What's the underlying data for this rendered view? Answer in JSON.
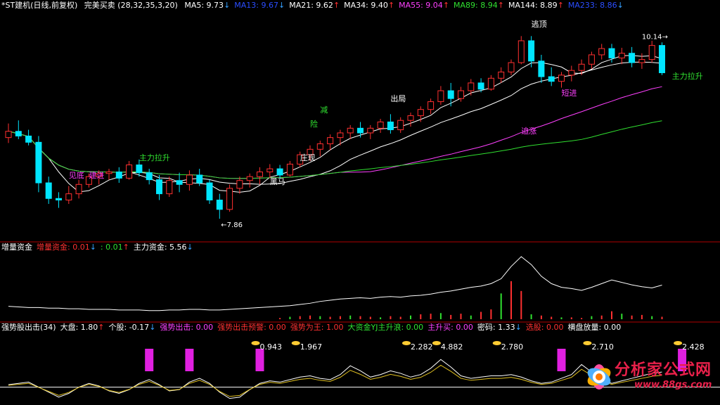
{
  "panel1": {
    "title": "*ST建机(日线,前复权)",
    "indicator": "完美买卖",
    "params": "(28,32,35,3,20)",
    "ma": [
      {
        "label": "MA5: 9.73",
        "arrow": "↓",
        "color": "#ffffff",
        "arrow_color": "#35a0ff"
      },
      {
        "label": "MA13: 9.67",
        "arrow": "↓",
        "color": "#2a4dff",
        "arrow_color": "#35a0ff"
      },
      {
        "label": "MA21: 9.62",
        "arrow": "↑",
        "color": "#ffffff",
        "arrow_color": "#ff3030"
      },
      {
        "label": "MA34: 9.40",
        "arrow": "↑",
        "color": "#ffffff",
        "arrow_color": "#ff3030"
      },
      {
        "label": "MA55: 9.04",
        "arrow": "↑",
        "color": "#ff40ff",
        "arrow_color": "#ff3030"
      },
      {
        "label": "MA89: 8.94",
        "arrow": "↑",
        "color": "#30e030",
        "arrow_color": "#ff3030"
      },
      {
        "label": "MA144: 8.89",
        "arrow": "↑",
        "color": "#ffffff",
        "arrow_color": "#ff3030"
      },
      {
        "label": "MA233: 8.86",
        "arrow": "↓",
        "color": "#2a4dff",
        "arrow_color": "#35a0ff"
      }
    ],
    "annotations": [
      {
        "text": "主力拉升",
        "color": "#30e030"
      },
      {
        "text": "见底",
        "color": "#ff40ff"
      },
      {
        "text": "建进",
        "color": "#ff40ff"
      },
      {
        "text": "黑马",
        "color": "#ffffff"
      },
      {
        "text": "庄现",
        "color": "#ffffff"
      },
      {
        "text": "减",
        "color": "#30e030"
      },
      {
        "text": "险",
        "color": "#30e030"
      },
      {
        "text": "出局",
        "color": "#ffffff"
      },
      {
        "text": "逃顶",
        "color": "#ffffff"
      },
      {
        "text": "短进",
        "color": "#ff40ff"
      },
      {
        "text": "追涨",
        "color": "#ff40ff"
      },
      {
        "text": "主力拉升",
        "color": "#30e030"
      }
    ],
    "price_labels": {
      "low": "7.86",
      "high": "10.14"
    }
  },
  "panel2": {
    "items": [
      {
        "text": "增量资金",
        "color": "#ffffff"
      },
      {
        "text": "增量资金: 0.01",
        "color": "#ff3030",
        "arrow": "↓",
        "arrow_color": "#35a0ff"
      },
      {
        "text": ": 0.01",
        "color": "#30e030",
        "arrow": "↑",
        "arrow_color": "#ff3030"
      },
      {
        "text": "主力资金: 5.56",
        "color": "#ffffff",
        "arrow": "↓",
        "arrow_color": "#35a0ff"
      }
    ]
  },
  "panel3": {
    "items": [
      {
        "text": "强势股出击(34)",
        "color": "#ffffff"
      },
      {
        "text": "大盘: 1.80",
        "color": "#ffffff",
        "arrow": "↑",
        "arrow_color": "#ff3030"
      },
      {
        "text": "个股: -0.17",
        "color": "#ffffff",
        "arrow": "↓",
        "arrow_color": "#35a0ff"
      },
      {
        "text": "强势出击: 0.00",
        "color": "#ff40ff"
      },
      {
        "text": "强势出击预警: 0.00",
        "color": "#ff3030"
      },
      {
        "text": "强势为王: 1.00",
        "color": "#ff3030"
      },
      {
        "text": "大资金YJ主升浪: 0.00",
        "color": "#30e030"
      },
      {
        "text": "主升买: 0.00",
        "color": "#ff40ff"
      },
      {
        "text": "密码: 1.33",
        "color": "#ffffff",
        "arrow": "↓",
        "arrow_color": "#35a0ff"
      },
      {
        "text": "选股: 0.00",
        "color": "#ff3030"
      },
      {
        "text": "横盘放量: 0.00",
        "color": "#ffffff"
      }
    ],
    "peak_labels": [
      "0.943",
      "1.967",
      "2.282",
      "4.882",
      "2.780",
      "2.710",
      "2.428"
    ]
  },
  "watermark": {
    "title": "分析家公式网",
    "url": "www.88gs.com"
  },
  "colors": {
    "up": "#ff3030",
    "down": "#00e5ff",
    "bg": "#000000",
    "divider": "#b00000"
  },
  "chart_data": [
    {
      "type": "candlestick",
      "title": "*ST建机(日线,前复权)",
      "ylim": [
        7.6,
        10.5
      ],
      "note": "OHLC estimated from gridless chart",
      "ohlc": [
        [
          8.9,
          9.08,
          8.83,
          8.98
        ],
        [
          8.98,
          9.12,
          8.88,
          8.92
        ],
        [
          8.92,
          9.0,
          8.8,
          8.84
        ],
        [
          8.84,
          8.92,
          8.2,
          8.32
        ],
        [
          8.32,
          8.4,
          8.05,
          8.12
        ],
        [
          8.12,
          8.2,
          8.0,
          8.1
        ],
        [
          8.1,
          8.28,
          8.05,
          8.18
        ],
        [
          8.18,
          8.36,
          8.12,
          8.3
        ],
        [
          8.3,
          8.44,
          8.26,
          8.4
        ],
        [
          8.4,
          8.48,
          8.3,
          8.44
        ],
        [
          8.44,
          8.5,
          8.36,
          8.46
        ],
        [
          8.46,
          8.52,
          8.32,
          8.38
        ],
        [
          8.38,
          8.6,
          8.36,
          8.55
        ],
        [
          8.55,
          8.62,
          8.4,
          8.45
        ],
        [
          8.45,
          8.5,
          8.3,
          8.36
        ],
        [
          8.36,
          8.42,
          8.1,
          8.18
        ],
        [
          8.18,
          8.4,
          8.14,
          8.35
        ],
        [
          8.35,
          8.45,
          8.2,
          8.3
        ],
        [
          8.3,
          8.48,
          8.22,
          8.42
        ],
        [
          8.42,
          8.5,
          8.28,
          8.32
        ],
        [
          8.32,
          8.36,
          8.05,
          8.1
        ],
        [
          8.1,
          8.18,
          7.86,
          7.98
        ],
        [
          7.98,
          8.3,
          7.95,
          8.25
        ],
        [
          8.25,
          8.4,
          8.18,
          8.35
        ],
        [
          8.35,
          8.44,
          8.26,
          8.4
        ],
        [
          8.4,
          8.52,
          8.3,
          8.46
        ],
        [
          8.46,
          8.56,
          8.38,
          8.5
        ],
        [
          8.5,
          8.55,
          8.38,
          8.42
        ],
        [
          8.42,
          8.6,
          8.4,
          8.56
        ],
        [
          8.56,
          8.72,
          8.52,
          8.68
        ],
        [
          8.68,
          8.8,
          8.6,
          8.75
        ],
        [
          8.75,
          8.86,
          8.66,
          8.82
        ],
        [
          8.82,
          8.94,
          8.74,
          8.9
        ],
        [
          8.9,
          9.0,
          8.8,
          8.96
        ],
        [
          8.96,
          9.06,
          8.88,
          9.02
        ],
        [
          9.02,
          9.1,
          8.9,
          8.96
        ],
        [
          8.96,
          9.06,
          8.88,
          9.02
        ],
        [
          9.02,
          9.14,
          8.96,
          9.1
        ],
        [
          9.1,
          9.2,
          8.95,
          9.0
        ],
        [
          9.0,
          9.16,
          8.96,
          9.12
        ],
        [
          9.12,
          9.22,
          9.04,
          9.18
        ],
        [
          9.18,
          9.3,
          9.1,
          9.26
        ],
        [
          9.26,
          9.4,
          9.2,
          9.36
        ],
        [
          9.36,
          9.56,
          9.32,
          9.5
        ],
        [
          9.5,
          9.6,
          9.3,
          9.4
        ],
        [
          9.4,
          9.55,
          9.36,
          9.5
        ],
        [
          9.5,
          9.65,
          9.44,
          9.6
        ],
        [
          9.6,
          9.66,
          9.48,
          9.52
        ],
        [
          9.52,
          9.7,
          9.5,
          9.66
        ],
        [
          9.66,
          9.8,
          9.6,
          9.74
        ],
        [
          9.74,
          9.9,
          9.7,
          9.86
        ],
        [
          9.86,
          10.2,
          9.84,
          10.14
        ],
        [
          10.14,
          10.2,
          9.8,
          9.88
        ],
        [
          9.88,
          9.96,
          9.6,
          9.68
        ],
        [
          9.68,
          9.8,
          9.56,
          9.62
        ],
        [
          9.62,
          9.74,
          9.54,
          9.7
        ],
        [
          9.7,
          9.82,
          9.62,
          9.76
        ],
        [
          9.76,
          9.9,
          9.7,
          9.84
        ],
        [
          9.84,
          10.0,
          9.78,
          9.96
        ],
        [
          9.96,
          10.1,
          9.9,
          10.04
        ],
        [
          10.04,
          10.1,
          9.86,
          9.92
        ],
        [
          9.92,
          10.05,
          9.84,
          9.98
        ],
        [
          9.98,
          10.06,
          9.8,
          9.86
        ],
        [
          9.86,
          9.98,
          9.78,
          9.9
        ],
        [
          9.9,
          10.14,
          9.86,
          10.08
        ],
        [
          10.08,
          10.12,
          9.7,
          9.73
        ]
      ]
    },
    {
      "type": "line",
      "title": "增量资金",
      "series": [
        {
          "name": "主力资金",
          "values": [
            2.1,
            2.0,
            1.9,
            1.9,
            1.8,
            1.8,
            1.7,
            1.7,
            1.6,
            1.6,
            1.6,
            1.5,
            1.5,
            1.5,
            1.4,
            1.4,
            1.5,
            1.5,
            1.6,
            1.6,
            1.5,
            1.5,
            1.6,
            1.7,
            1.8,
            1.9,
            2.0,
            2.1,
            2.2,
            2.4,
            2.6,
            2.9,
            3.1,
            3.3,
            3.4,
            3.5,
            3.4,
            3.6,
            3.7,
            3.6,
            3.8,
            3.9,
            4.1,
            4.4,
            4.6,
            4.9,
            5.2,
            5.4,
            5.8,
            6.6,
            8.6,
            10.2,
            8.9,
            7.0,
            5.8,
            5.2,
            5.0,
            4.7,
            5.2,
            5.8,
            6.4,
            6.0,
            5.6,
            5.3,
            5.1,
            5.56
          ]
        }
      ],
      "bars": [
        0,
        0,
        0,
        0,
        0,
        0,
        0,
        0,
        0,
        0,
        0,
        0,
        0,
        0,
        0,
        0,
        0,
        0,
        0,
        0,
        0,
        0,
        0,
        0,
        0,
        0,
        0,
        0.2,
        0.4,
        0.5,
        0.6,
        0.5,
        0.4,
        0.5,
        0.6,
        0.5,
        0.4,
        0.3,
        0.5,
        0.4,
        0.6,
        0.8,
        0.9,
        1.0,
        0.7,
        0.9,
        0.6,
        1.2,
        1.6,
        4.2,
        6.2,
        4.6,
        0.8,
        0.6,
        0.4,
        0.3,
        0.3,
        0.2,
        0.5,
        0.6,
        1.3,
        0.9,
        0.6,
        0.7,
        0.5,
        0.4
      ]
    },
    {
      "type": "line",
      "title": "强势股出击(34)",
      "series": [
        {
          "name": "大盘",
          "values": [
            0.8,
            0.9,
            1.0,
            0.6,
            0.2,
            -0.2,
            0.1,
            0.6,
            0.9,
            0.7,
            0.3,
            0.1,
            0.4,
            0.9,
            1.2,
            0.8,
            0.3,
            0.4,
            1.0,
            1.3,
            0.9,
            0.2,
            -0.3,
            -0.2,
            0.4,
            0.9,
            1.1,
            1.0,
            1.2,
            1.4,
            1.5,
            1.3,
            1.2,
            1.6,
            2.3,
            1.9,
            1.4,
            1.6,
            1.9,
            1.7,
            1.4,
            1.6,
            2.1,
            2.8,
            2.2,
            1.5,
            1.3,
            1.4,
            1.5,
            1.5,
            1.6,
            1.4,
            1.1,
            0.9,
            1.0,
            1.3,
            1.6,
            2.4,
            1.8,
            1.2,
            0.9,
            1.1,
            1.3,
            1.5,
            1.7,
            1.8
          ]
        }
      ],
      "peaks": [
        "0.943",
        "1.967",
        "2.282",
        "4.882",
        "2.780",
        "2.710",
        "2.428"
      ]
    }
  ]
}
